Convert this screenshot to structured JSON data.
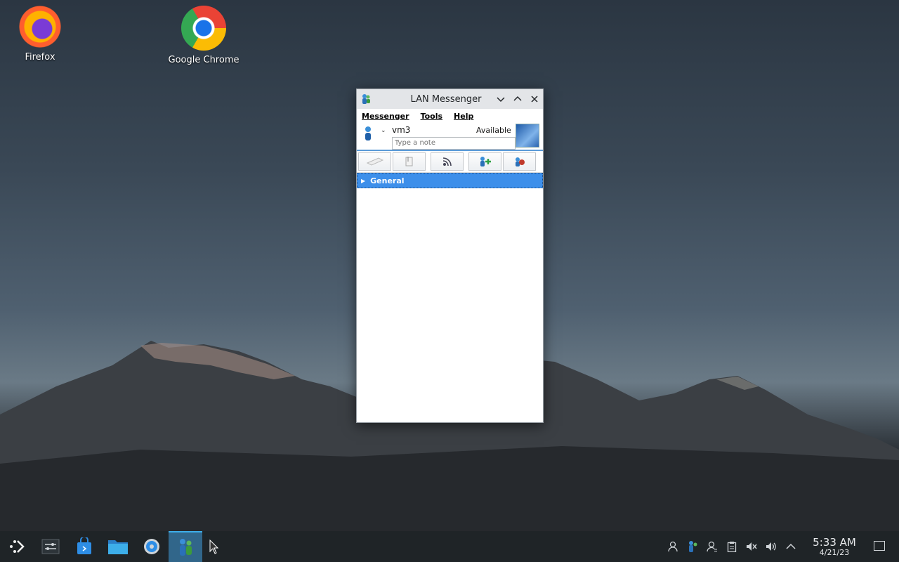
{
  "desktop": {
    "icons": [
      {
        "label": "Firefox",
        "icon": "firefox-icon"
      },
      {
        "label": "Google Chrome",
        "icon": "chrome-icon"
      }
    ]
  },
  "window": {
    "title": "LAN Messenger",
    "controls": [
      "minimize",
      "maximize",
      "close"
    ],
    "menu": [
      "Messenger",
      "Tools",
      "Help"
    ],
    "user": {
      "name": "vm3",
      "status": "Available",
      "note_placeholder": "Type a note"
    },
    "toolbar": [
      "broadcast-icon",
      "file-transfer-icon",
      "rss-icon",
      "add-contact-icon",
      "settings-icon"
    ],
    "groups": [
      {
        "label": "General",
        "expanded": false
      }
    ]
  },
  "taskbar": {
    "apps": [
      "launcher-icon",
      "task-manager-icon",
      "discover-store-icon",
      "file-manager-icon",
      "system-settings-icon",
      "lan-messenger-icon"
    ],
    "tray": [
      "user-icon",
      "lan-messenger-tray-icon",
      "network-user-icon",
      "clipboard-icon",
      "mute-icon",
      "volume-icon",
      "expand-tray-icon"
    ],
    "clock": {
      "time": "5:33 AM",
      "date": "4/21/23"
    }
  },
  "colors": {
    "selection": "#3d8fea",
    "accent": "#3daee9",
    "taskbar": "#1f2427"
  }
}
